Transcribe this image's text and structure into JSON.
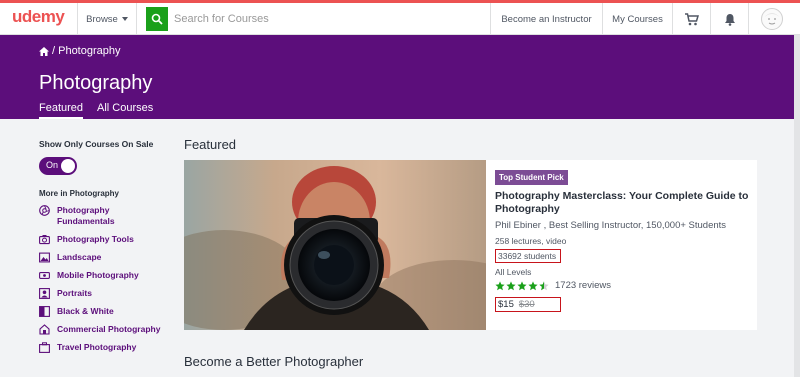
{
  "header": {
    "logo": "udemy",
    "browse": "Browse",
    "search_placeholder": "Search for Courses",
    "become_instructor": "Become an Instructor",
    "my_courses": "My Courses"
  },
  "hero": {
    "breadcrumb": "/ Photography",
    "title": "Photography",
    "tabs": [
      "Featured",
      "All Courses"
    ]
  },
  "sidebar": {
    "sale_title": "Show Only Courses On Sale",
    "toggle_label": "On",
    "more_title": "More in Photography",
    "items": [
      {
        "label": "Photography Fundamentals",
        "icon": "aperture-icon"
      },
      {
        "label": "Photography Tools",
        "icon": "camera-icon"
      },
      {
        "label": "Landscape",
        "icon": "landscape-icon"
      },
      {
        "label": "Mobile Photography",
        "icon": "mobile-icon"
      },
      {
        "label": "Portraits",
        "icon": "portrait-icon"
      },
      {
        "label": "Black & White",
        "icon": "contrast-icon"
      },
      {
        "label": "Commercial Photography",
        "icon": "commercial-icon"
      },
      {
        "label": "Travel Photography",
        "icon": "travel-icon"
      }
    ]
  },
  "main": {
    "featured_heading": "Featured",
    "course": {
      "badge": "Top Student Pick",
      "title": "Photography Masterclass: Your Complete Guide to Photography",
      "instructor": "Phil Ebiner , Best Selling Instructor, 150,000+ Students",
      "meta": "258 lectures, video",
      "students": "33692 students",
      "levels": "All Levels",
      "rating": 4.5,
      "reviews": "1723 reviews",
      "price": "$15",
      "old_price": "$30"
    },
    "section_heading": "Become a Better Photographer"
  },
  "colors": {
    "brand_red": "#ec5252",
    "purple": "#5c0e7b",
    "search_green": "#1aa01a",
    "star": "#1aa01a"
  }
}
